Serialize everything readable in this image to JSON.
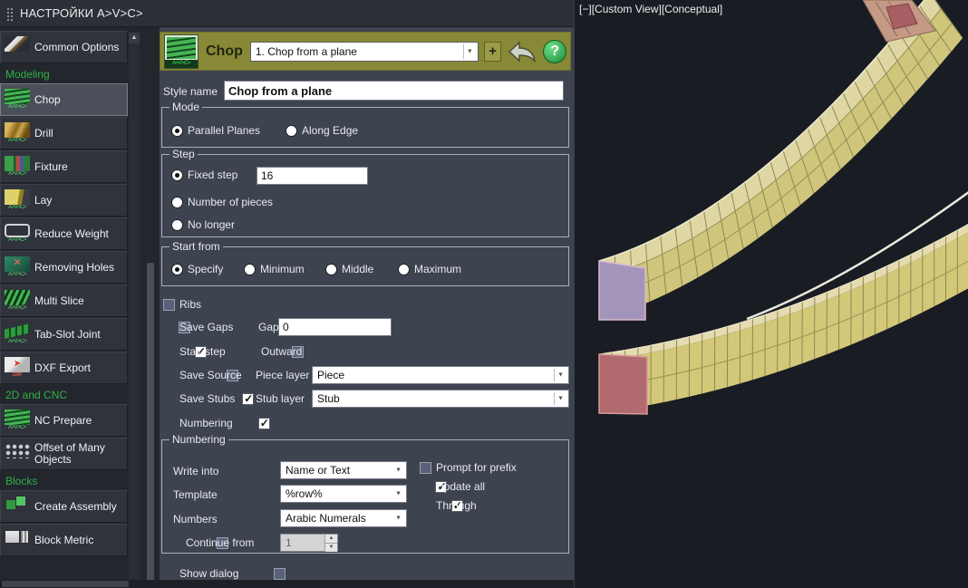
{
  "titlebar": {
    "title": "НАСТРОЙКИ A>V>C>"
  },
  "sidebar": {
    "rows": [
      {
        "type": "item",
        "label": "Common Options",
        "icon_caption": "",
        "selected": false
      },
      {
        "type": "header",
        "label": "Modeling"
      },
      {
        "type": "item",
        "label": "Chop",
        "icon_caption": "A>V>C>",
        "selected": true
      },
      {
        "type": "item",
        "label": "Drill",
        "icon_caption": "A>V>C>",
        "selected": false
      },
      {
        "type": "item",
        "label": "Fixture",
        "icon_caption": "A>V>C>",
        "selected": false
      },
      {
        "type": "item",
        "label": "Lay",
        "icon_caption": "A>V>C>",
        "selected": false
      },
      {
        "type": "item",
        "label": "Reduce Weight",
        "icon_caption": "A>V>C>",
        "selected": false
      },
      {
        "type": "item",
        "label": "Removing Holes",
        "icon_caption": "A>V>C>",
        "selected": false
      },
      {
        "type": "item",
        "label": "Multi Slice",
        "icon_caption": "A>V>C>",
        "selected": false
      },
      {
        "type": "item",
        "label": "Tab-Slot Joint",
        "icon_caption": "A>V>C>",
        "selected": false
      },
      {
        "type": "item",
        "label": "DXF Export",
        "icon_caption": "DXF",
        "selected": false
      },
      {
        "type": "header",
        "label": "2D and CNC"
      },
      {
        "type": "item",
        "label": "NC Prepare",
        "icon_caption": "A>V>C>",
        "selected": false
      },
      {
        "type": "item",
        "label": "Offset of Many Objects",
        "icon_caption": "",
        "selected": false
      },
      {
        "type": "header",
        "label": "Blocks"
      },
      {
        "type": "item",
        "label": "Create Assembly",
        "icon_caption": "",
        "selected": false
      },
      {
        "type": "item",
        "label": "Block Metric",
        "icon_caption": "",
        "selected": false
      }
    ]
  },
  "panel": {
    "header": {
      "tool_label": "Chop",
      "icon_caption": "A>V>C>",
      "style_combo": "1. Chop from a plane",
      "add_button": "+",
      "help_glyph": "?"
    },
    "style_name": {
      "label": "Style name",
      "value": "Chop from a plane"
    },
    "mode": {
      "title": "Mode",
      "parallel": {
        "label": "Parallel Planes",
        "selected": true
      },
      "along": {
        "label": "Along Edge",
        "selected": false
      }
    },
    "step": {
      "title": "Step",
      "fixed": {
        "label": "Fixed step",
        "selected": true,
        "value": "16"
      },
      "pieces": {
        "label": "Number of pieces",
        "selected": false
      },
      "nolonger": {
        "label": "No longer",
        "selected": false
      }
    },
    "start": {
      "title": "Start from",
      "specify": {
        "label": "Specify",
        "selected": true
      },
      "minimum": {
        "label": "Minimum",
        "selected": false
      },
      "middle": {
        "label": "Middle",
        "selected": false
      },
      "maximum": {
        "label": "Maximum",
        "selected": false
      }
    },
    "options": {
      "ribs": {
        "label": "Ribs",
        "checked": false
      },
      "save_gaps": {
        "label": "Save Gaps",
        "checked": false
      },
      "gap": {
        "label": "Gap",
        "value": "0"
      },
      "stair_step": {
        "label": "Stair step",
        "checked": true
      },
      "outward": {
        "label": "Outward",
        "checked": false
      },
      "save_source": {
        "label": "Save Source",
        "checked": false
      },
      "piece_layer": {
        "label": "Piece layer",
        "value": "Piece"
      },
      "save_stubs": {
        "label": "Save Stubs",
        "checked": true
      },
      "stub_layer": {
        "label": "Stub layer",
        "value": "Stub"
      },
      "numbering": {
        "label": "Numbering",
        "checked": true
      }
    },
    "numbering": {
      "title": "Numbering",
      "write_into": {
        "label": "Write into",
        "value": "Name or Text"
      },
      "prompt_prefix": {
        "label": "Prompt for prefix",
        "checked": false
      },
      "template": {
        "label": "Template",
        "value": "%row%"
      },
      "update_all": {
        "label": "Update all",
        "checked": true
      },
      "numbers": {
        "label": "Numbers",
        "value": "Arabic Numerals"
      },
      "through": {
        "label": "Through",
        "checked": true
      },
      "continue_from": {
        "label": "Continue from",
        "checked": false,
        "value": "1"
      }
    },
    "show_dialog": {
      "label": "Show dialog",
      "checked": false
    }
  },
  "viewport": {
    "controls": [
      "[−]",
      "[Custom View]",
      "[Conceptual]"
    ]
  },
  "colors": {
    "accent_green": "#2fb14c",
    "header_olive": "#878937",
    "panel_bg": "#3e4350",
    "viewport_bg": "#191c23"
  }
}
